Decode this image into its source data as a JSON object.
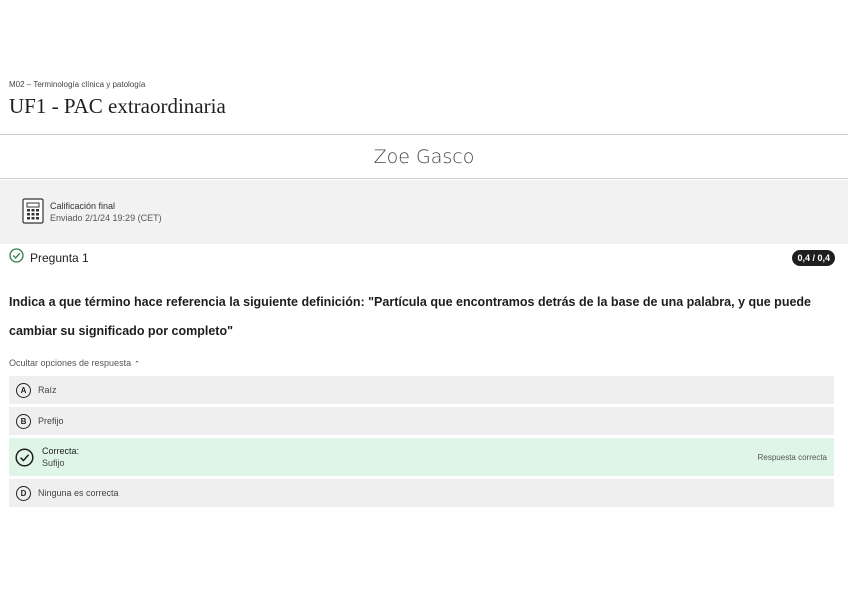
{
  "header": {
    "course": "M02 – Terminología clínica y patología",
    "title": "UF1 - PAC extraordinaria"
  },
  "student": {
    "name": "Zoe Gasco"
  },
  "grade": {
    "label": "Calificación final",
    "submitted": "Enviado 2/1/24 19:29 (CET)",
    "icon": "calculator-icon"
  },
  "question": {
    "label": "Pregunta 1",
    "score": "0,4 / 0,4",
    "status_icon": "check-circle-icon",
    "text": "Indica a que término hace referencia la siguiente definición: \"Partícula que encontramos detrás de la base de una palabra, y que puede cambiar su significado por completo\"",
    "toggle_label": "Ocultar opciones de respuesta",
    "options": [
      {
        "letter": "A",
        "text": "Raíz"
      },
      {
        "letter": "B",
        "text": "Prefijo"
      },
      {
        "correct_label": "Correcta:",
        "text": "Sufijo",
        "right_label": "Respuesta correcta"
      },
      {
        "letter": "D",
        "text": "Ninguna es correcta"
      }
    ]
  },
  "colors": {
    "correct_bg": "#dff5e7",
    "option_bg": "#efefef",
    "badge_bg": "#1f1f1f"
  }
}
